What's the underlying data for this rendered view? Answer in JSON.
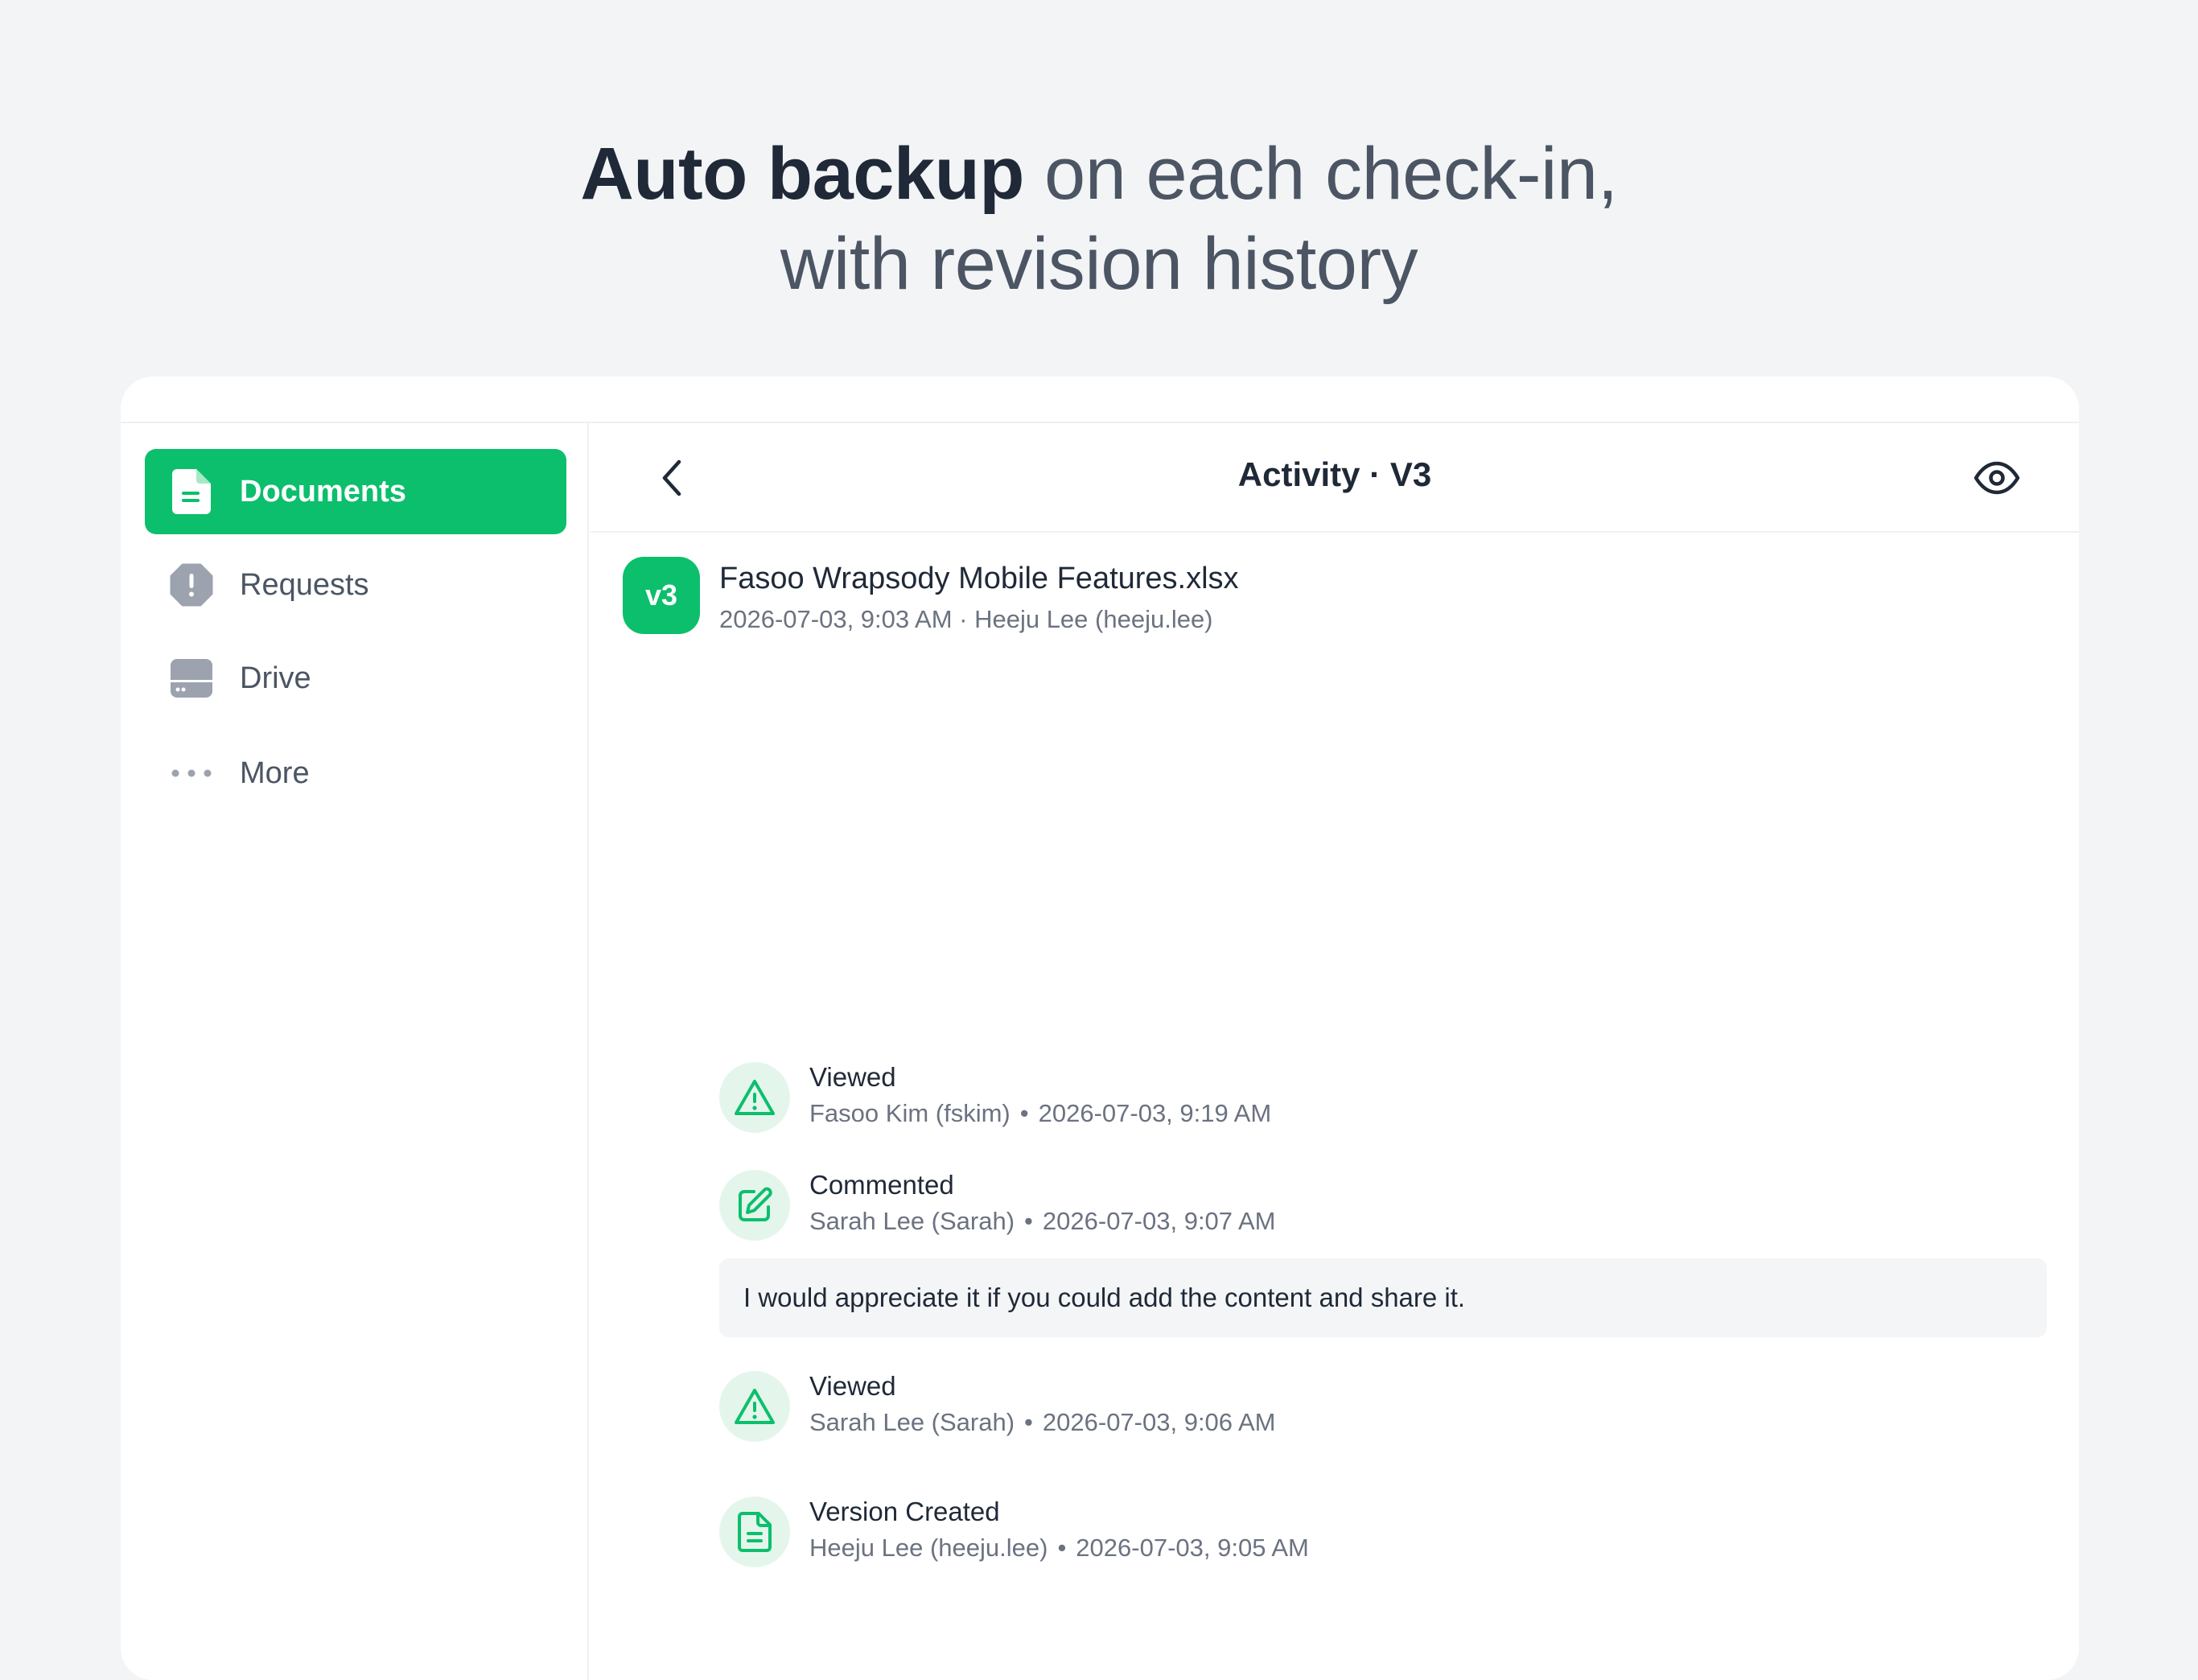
{
  "headline": {
    "strong": "Auto backup",
    "rest": " on each check-in,",
    "line2": "with revision history"
  },
  "sidebar": {
    "items": [
      {
        "label": "Documents",
        "icon": "document-icon",
        "active": true
      },
      {
        "label": "Requests",
        "icon": "alert-octagon-icon",
        "active": false
      },
      {
        "label": "Drive",
        "icon": "drive-icon",
        "active": false
      },
      {
        "label": "More",
        "icon": "more-dots-icon",
        "active": false
      }
    ]
  },
  "header": {
    "title": "Activity · V3"
  },
  "file": {
    "badge": "v3",
    "name": "Fasoo Wrapsody Mobile Features.xlsx",
    "meta": "2026-07-03, 9:03 AM · Heeju Lee (heeju.lee)"
  },
  "activities": [
    {
      "title": "Viewed",
      "user": "Fasoo Kim (fskim)",
      "time": "2026-07-03, 9:19 AM",
      "icon": "warning-triangle-icon"
    },
    {
      "title": "Commented",
      "user": "Sarah Lee (Sarah)",
      "time": "2026-07-03, 9:07 AM",
      "icon": "edit-pen-icon"
    },
    {
      "title": "Viewed",
      "user": "Sarah Lee (Sarah)",
      "time": "2026-07-03, 9:06 AM",
      "icon": "warning-triangle-icon"
    },
    {
      "title": "Version Created",
      "user": "Heeju Lee (heeju.lee)",
      "time": "2026-07-03, 9:05 AM",
      "icon": "document-lines-icon"
    }
  ],
  "comment": {
    "text": "I would appreciate it if you could add the content and share it."
  },
  "separator": "•",
  "colors": {
    "accent": "#0cbf6c",
    "accent_soft": "#e4f6ec",
    "background": "#f3f4f6",
    "text_primary": "#1f2937",
    "text_secondary": "#6b7280"
  }
}
